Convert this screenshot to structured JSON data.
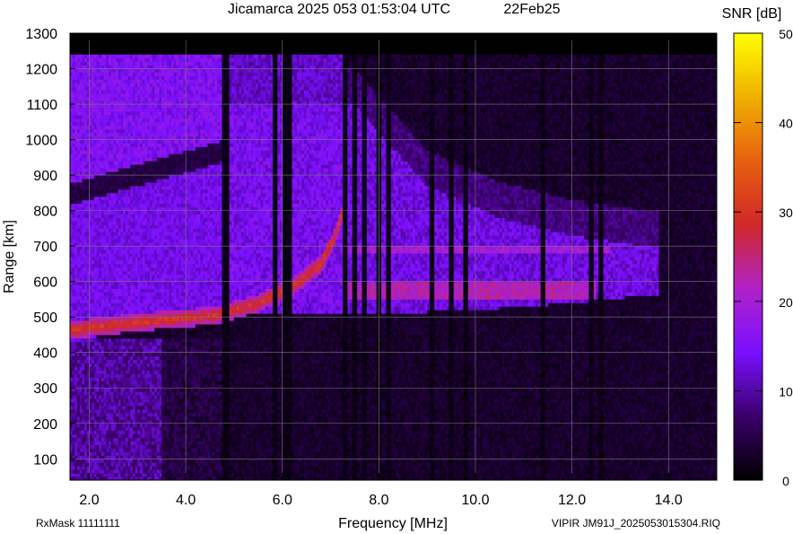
{
  "header": {
    "title": "Jicamarca 2025 053 01:53:04 UTC",
    "date": "22Feb25"
  },
  "footer": {
    "rxmask": "RxMask 11111111",
    "file": "VIPIR  JM91J_2025053015304.RIQ"
  },
  "colorbar": {
    "label": "SNR [dB]",
    "ticks": [
      0,
      10,
      20,
      30,
      40,
      50
    ],
    "range": [
      0,
      50
    ],
    "colors": [
      "#000000",
      "#3a006a",
      "#7a10ff",
      "#b022c8",
      "#d02828",
      "#e86010",
      "#f0b000",
      "#ffff00"
    ]
  },
  "chart_data": {
    "type": "heatmap",
    "title": "Jicamarca 2025 053 01:53:04 UTC",
    "xlabel": "Frequency [MHz]",
    "ylabel": "Range [km]",
    "xlim": [
      1.6,
      15.0
    ],
    "ylim": [
      40,
      1300
    ],
    "xticks": [
      "2.0",
      "4.0",
      "6.0",
      "8.0",
      "10.0",
      "12.0",
      "14.0"
    ],
    "xtick_values": [
      2,
      4,
      6,
      8,
      10,
      12,
      14
    ],
    "yticks": [
      100,
      200,
      300,
      400,
      500,
      600,
      700,
      800,
      900,
      1000,
      1100,
      1200,
      1300
    ],
    "grid": true,
    "colorbar_label": "SNR [dB]",
    "data_range_km": [
      40,
      1240
    ],
    "traces": {
      "o_mode": {
        "freq": [
          1.7,
          2.5,
          3.5,
          4.6,
          5.5,
          6.2,
          6.8,
          7.1,
          7.25
        ],
        "range": [
          465,
          478,
          492,
          505,
          540,
          585,
          650,
          730,
          800
        ]
      },
      "lower_edge": {
        "freq": [
          1.7,
          3.0,
          4.6,
          6.0,
          8.0,
          10.0,
          12.0,
          13.5
        ],
        "range": [
          440,
          485,
          505,
          508,
          510,
          520,
          540,
          560
        ]
      },
      "x_echo_edge": {
        "freq": [
          1.7,
          3.0,
          4.6,
          6.0
        ],
        "range": [
          880,
          930,
          990,
          1060
        ]
      },
      "upper_spread": {
        "freq": [
          7.5,
          9.0,
          10.5,
          12.0,
          13.5
        ],
        "range": [
          1100,
          870,
          780,
          730,
          700
        ]
      }
    },
    "interference_mhz": [
      4.8,
      4.85,
      5.85,
      6.05,
      6.15,
      7.3,
      7.5,
      7.7,
      8.0,
      8.2,
      9.1,
      9.5,
      9.8,
      11.4,
      12.4,
      12.6
    ]
  }
}
